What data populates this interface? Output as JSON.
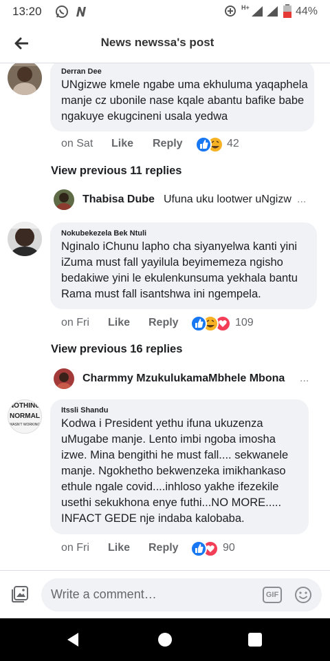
{
  "status_bar": {
    "time": "13:20",
    "network": "H+",
    "battery": "44%"
  },
  "header": {
    "title": "News newssa's post"
  },
  "comments": [
    {
      "name": "Derran Dee",
      "text": "UNgizwe kmele ngabe uma ekhuluma yaqaphela manje cz ubonile nase kqale abantu bafike babe ngakuye ekugcineni usala yedwa",
      "time": "on Sat",
      "like": "Like",
      "reply": "Reply",
      "reactions": [
        "like",
        "haha"
      ],
      "count": "42"
    },
    {
      "name": "Nokubekezela Bek Ntuli",
      "text": "Nginalo iChunu lapho cha siyanyelwa kanti yini iZuma must fall yayilula beyimemeza ngisho bedakiwe yini le ekulenkunsuma yekhala bantu Rama must fall isantshwa ini ngempela.",
      "time": "on Fri",
      "like": "Like",
      "reply": "Reply",
      "reactions": [
        "like",
        "haha",
        "love"
      ],
      "count": "109"
    },
    {
      "name": "Itssli Shandu",
      "text": "Kodwa i President yethu ifuna ukuzenza uMugabe manje. Lento imbi ngoba imosha izwe.  Mina bengithi he must fall.... sekwanele manje. Ngokhetho bekwenzeka imikhankaso ethule ngale covid....inhloso yakhe ifezekile usethi sekukhona enye futhi...NO MORE..... INFACT GEDE nje indaba kalobaba.",
      "time": "on Fri",
      "like": "Like",
      "reply": "Reply",
      "reactions": [
        "like",
        "love"
      ],
      "count": "90",
      "avatar_text": [
        "NOTHING",
        "NORMAL",
        "WASN'T WORKING"
      ]
    }
  ],
  "replies": [
    {
      "view_previous": "View previous 11 replies",
      "name": "Thabisa Dube",
      "snippet": "Ufuna uku lootwer uNgizw",
      "more": "..."
    },
    {
      "view_previous": "View previous 16 replies",
      "name": "Charmmy MzukulukamaMbhele Mbona",
      "snippet": "",
      "more": "..."
    }
  ],
  "composer": {
    "placeholder": "Write a comment…",
    "gif": "GIF"
  },
  "colors": {
    "accent": "#1877f2",
    "bubble": "#f0f2f5",
    "haha": "#f7b125",
    "love": "#f33e58"
  }
}
